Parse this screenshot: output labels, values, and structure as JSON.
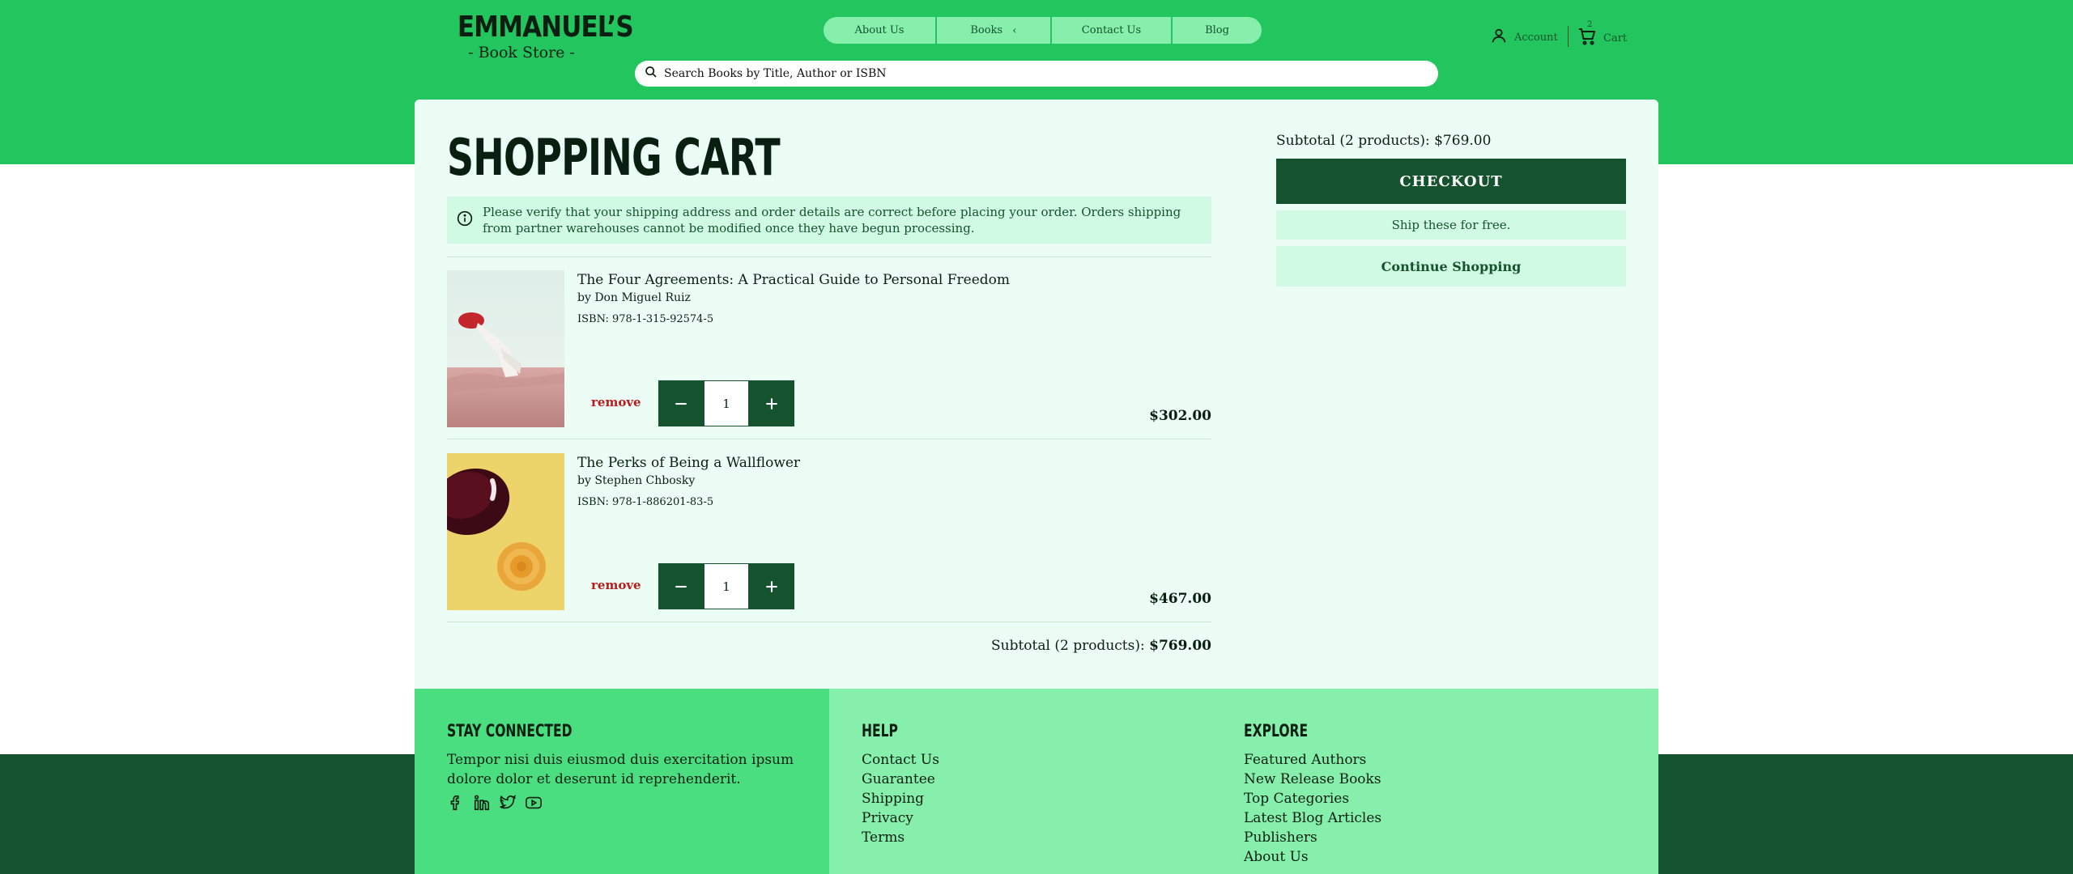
{
  "colors": {
    "brand_green": "#22c55e",
    "dark_green": "#14532d",
    "light_mint": "#ecfdf5",
    "pale_green": "#d1fae5",
    "remove_red": "#b91c1c"
  },
  "header": {
    "logo_name": "EMMANUEL’S",
    "logo_sub": "- Book Store -",
    "nav": [
      {
        "label": "About Us"
      },
      {
        "label": "Books",
        "icon": "chevron-left-icon"
      },
      {
        "label": "Contact Us"
      },
      {
        "label": "Blog"
      }
    ],
    "search_placeholder": "Search Books by Title, Author or ISBN",
    "account_label": "Account",
    "cart_label": "Cart",
    "cart_count": "2"
  },
  "main": {
    "title": "SHOPPING CART",
    "notice": "Please verify that your shipping address and order details are correct before placing your order. Orders shipping from partner warehouses cannot be modified once they have begun processing.",
    "items": [
      {
        "title": "The Four Agreements: A Practical Guide to Personal Freedom",
        "author": "by Don Miguel Ruiz",
        "isbn": "ISBN: 978-1-315-92574-5",
        "remove_label": "remove",
        "quantity": "1",
        "price": "$302.00"
      },
      {
        "title": "The Perks of Being a Wallflower",
        "author": "by Stephen Chbosky",
        "isbn": "ISBN: 978-1-886201-83-5",
        "remove_label": "remove",
        "quantity": "1",
        "price": "$467.00"
      }
    ],
    "subtotal_label": "Subtotal (2 products):",
    "subtotal_value": "$769.00"
  },
  "summary": {
    "subtotal_text": "Subtotal (2 products): $769.00",
    "checkout_label": "CHECKOUT",
    "ship_free": "Ship these for free.",
    "continue_label": "Continue Shopping"
  },
  "footer": {
    "stay_connected": {
      "heading": "STAY CONNECTED",
      "text": "Tempor nisi duis eiusmod duis exercitation ipsum dolore dolor et deserunt id reprehenderit.",
      "socials": [
        "facebook-icon",
        "linkedin-icon",
        "twitter-icon",
        "youtube-icon"
      ]
    },
    "help": {
      "heading": "HELP",
      "links": [
        "Contact Us",
        "Guarantee",
        "Shipping",
        "Privacy",
        "Terms"
      ]
    },
    "explore": {
      "heading": "EXPLORE",
      "links": [
        "Featured Authors",
        "New Release Books",
        "Top Categories",
        "Latest Blog Articles",
        "Publishers",
        "About Us"
      ]
    }
  }
}
